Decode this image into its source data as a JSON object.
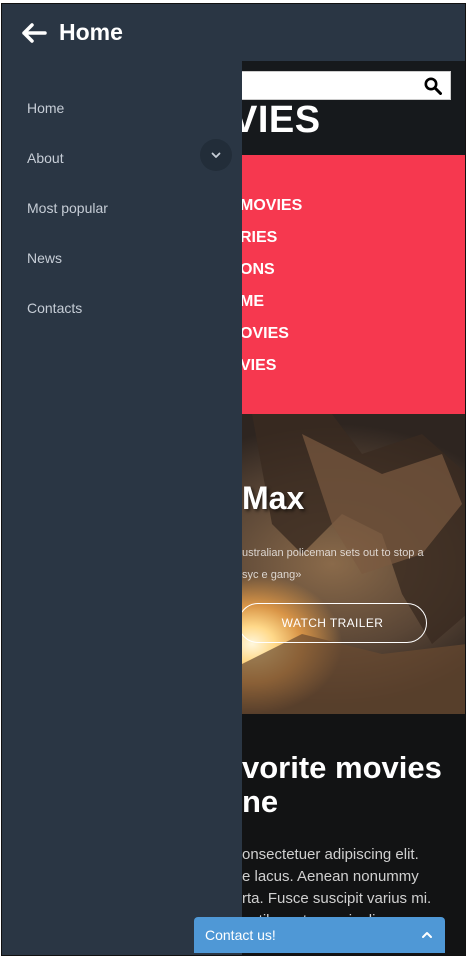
{
  "header": {
    "title": "Home",
    "back_icon": "arrow-left-icon"
  },
  "drawer": {
    "items": [
      {
        "label": "Home"
      },
      {
        "label": "About"
      },
      {
        "label": "Most popular"
      },
      {
        "label": "News"
      },
      {
        "label": "Contacts"
      }
    ],
    "expand_icon": "chevron-down-icon"
  },
  "page": {
    "search": {
      "placeholder": "",
      "icon": "search-icon"
    },
    "brand_partial": "VIES",
    "menu_items": [
      "MOVIES",
      "RIES",
      "ONS",
      "ME",
      "OVIES",
      "VIES"
    ],
    "hero": {
      "title_partial": "Max",
      "desc_partial": "ustralian policeman sets out to stop a\nsyc e gang»",
      "trailer_label": "WATCH TRAILER"
    },
    "favorites": {
      "title_line1": "vorite movies",
      "title_line2": "ne",
      "body": "onsectetuer adipiscing elit.\ne lacus. Aenean nonummy\nrta. Fusce suscipit varius mi.\nnatibus et magnis dis"
    }
  },
  "contact": {
    "label": "Contact us!",
    "icon": "chevron-up-icon"
  },
  "colors": {
    "header_bg": "#2a3644",
    "menu_red": "#f6384f",
    "contact_blue": "#4f98d6"
  }
}
